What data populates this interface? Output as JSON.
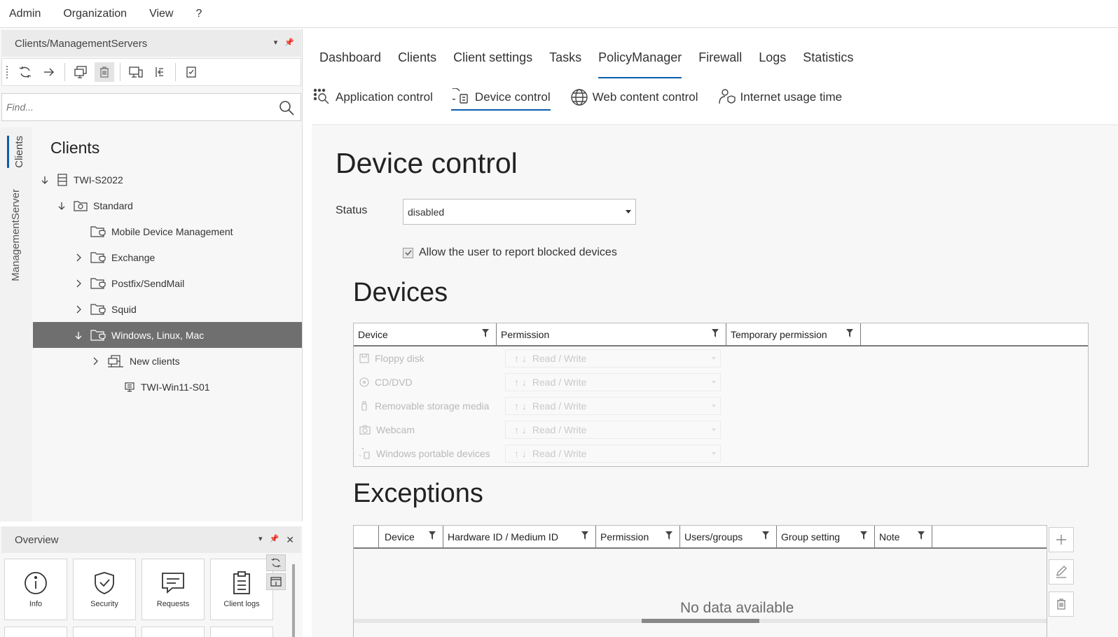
{
  "menu": [
    "Admin",
    "Organization",
    "View",
    "?"
  ],
  "left_panel": {
    "title": "Clients/ManagementServers",
    "find_placeholder": "Find...",
    "vertical_tabs": [
      "Clients",
      "ManagementServer"
    ],
    "tree_title": "Clients",
    "tree": [
      {
        "label": "TWI-S2022",
        "icon": "server-icon",
        "expand": "expanded"
      },
      {
        "label": "Standard",
        "icon": "group-folder-icon",
        "expand": "expanded"
      },
      {
        "label": "Mobile Device Management",
        "icon": "policy-folder-icon",
        "expand": "none"
      },
      {
        "label": "Exchange",
        "icon": "policy-folder-icon",
        "expand": "collapsed"
      },
      {
        "label": "Postfix/SendMail",
        "icon": "policy-folder-icon",
        "expand": "collapsed"
      },
      {
        "label": "Squid",
        "icon": "policy-folder-icon",
        "expand": "collapsed"
      },
      {
        "label": "Windows, Linux, Mac",
        "icon": "policy-folder-icon",
        "expand": "expanded"
      },
      {
        "label": "New clients",
        "icon": "new-clients-icon",
        "expand": "collapsed"
      },
      {
        "label": "TWI-Win11-S01",
        "icon": "computer-icon",
        "expand": "none"
      }
    ]
  },
  "overview": {
    "title": "Overview",
    "tiles": [
      "Info",
      "Security",
      "Requests",
      "Client logs"
    ]
  },
  "main": {
    "tabs": [
      "Dashboard",
      "Clients",
      "Client settings",
      "Tasks",
      "PolicyManager",
      "Firewall",
      "Logs",
      "Statistics"
    ],
    "active_tab": "PolicyManager",
    "subtabs": [
      "Application control",
      "Device control",
      "Web content control",
      "Internet usage time"
    ],
    "active_subtab": "Device control",
    "heading": "Device control",
    "status_label": "Status",
    "status_value": "disabled",
    "checkbox_label": "Allow the user to report blocked devices",
    "devices": {
      "heading": "Devices",
      "columns": [
        "Device",
        "Permission",
        "Temporary permission"
      ],
      "rows": [
        {
          "device": "Floppy disk",
          "permission": "Read / Write"
        },
        {
          "device": "CD/DVD",
          "permission": "Read / Write"
        },
        {
          "device": "Removable storage media",
          "permission": "Read / Write"
        },
        {
          "device": "Webcam",
          "permission": "Read / Write"
        },
        {
          "device": "Windows portable devices",
          "permission": "Read / Write"
        }
      ]
    },
    "exceptions": {
      "heading": "Exceptions",
      "columns": [
        "Device",
        "Hardware ID / Medium ID",
        "Permission",
        "Users/groups",
        "Group setting",
        "Note"
      ],
      "empty": "No data available"
    }
  },
  "colors": {
    "accent": "#0b5cad",
    "selected_row": "#6f6f6f"
  }
}
